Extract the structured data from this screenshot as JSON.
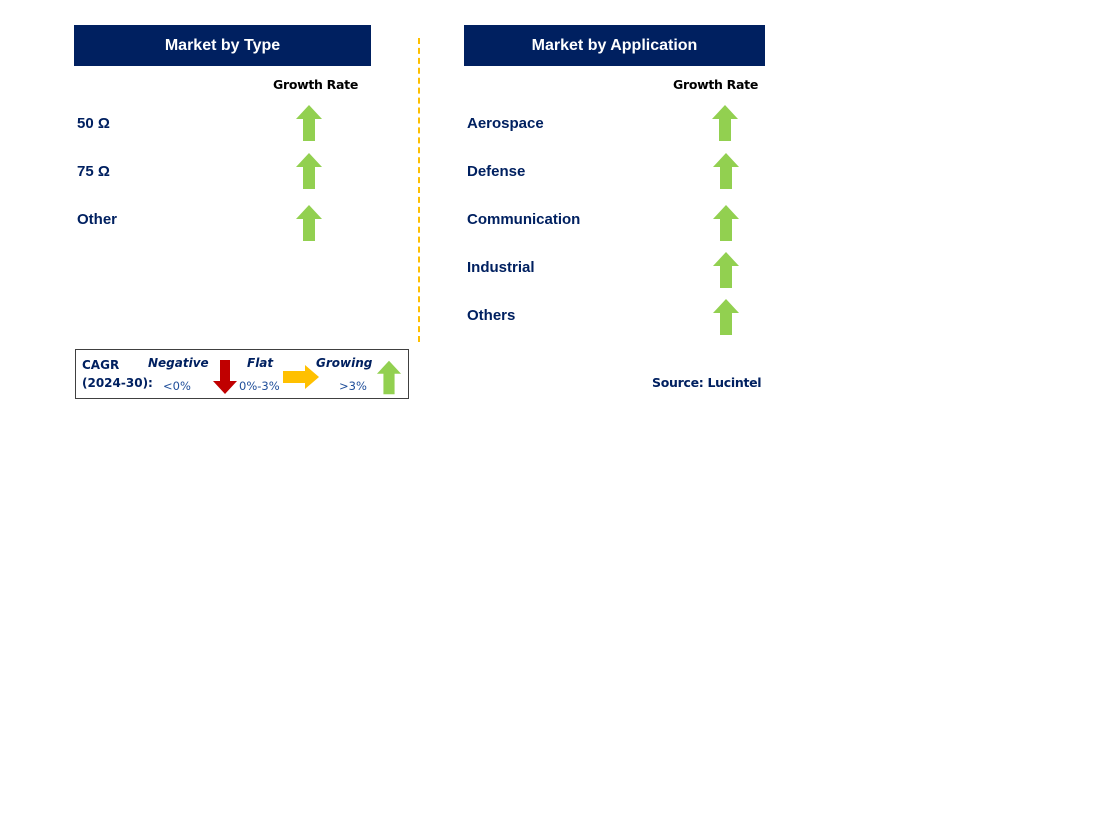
{
  "colors": {
    "header_bg": "#002060",
    "label_text": "#002060",
    "growing": "#92D050",
    "negative": "#C00000",
    "flat": "#FFC000",
    "divider": "#FFC000"
  },
  "type_panel": {
    "title": "Market by Type",
    "column_header": "Growth Rate",
    "rows": [
      {
        "label": "50 Ω",
        "trend": "growing",
        "icon": "arrow-up-icon"
      },
      {
        "label": "75 Ω",
        "trend": "growing",
        "icon": "arrow-up-icon"
      },
      {
        "label": "Other",
        "trend": "growing",
        "icon": "arrow-up-icon"
      }
    ]
  },
  "application_panel": {
    "title": "Market by Application",
    "column_header": "Growth Rate",
    "rows": [
      {
        "label": "Aerospace",
        "trend": "growing",
        "icon": "arrow-up-icon"
      },
      {
        "label": "Defense",
        "trend": "growing",
        "icon": "arrow-up-icon"
      },
      {
        "label": "Communication",
        "trend": "growing",
        "icon": "arrow-up-icon"
      },
      {
        "label": "Industrial",
        "trend": "growing",
        "icon": "arrow-up-icon"
      },
      {
        "label": "Others",
        "trend": "growing",
        "icon": "arrow-up-icon"
      }
    ]
  },
  "legend": {
    "cagr_label": "CAGR",
    "period_label": "(2024-30):",
    "negative": {
      "label": "Negative",
      "range": "<0%",
      "icon": "arrow-down-icon"
    },
    "flat": {
      "label": "Flat",
      "range": "0%-3%",
      "icon": "arrow-right-icon"
    },
    "growing": {
      "label": "Growing",
      "range": ">3%",
      "icon": "arrow-up-icon"
    }
  },
  "source": "Source: Lucintel"
}
